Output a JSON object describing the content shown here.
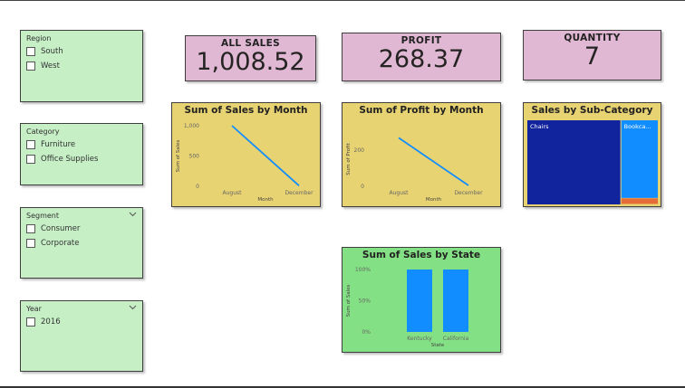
{
  "slicers": {
    "region": {
      "title": "Region",
      "has_dropdown": false,
      "items": [
        {
          "label": "South"
        },
        {
          "label": "West"
        }
      ]
    },
    "category": {
      "title": "Category",
      "has_dropdown": false,
      "items": [
        {
          "label": "Furniture"
        },
        {
          "label": "Office Supplies"
        }
      ]
    },
    "segment": {
      "title": "Segment",
      "has_dropdown": true,
      "items": [
        {
          "label": "Consumer"
        },
        {
          "label": "Corporate"
        }
      ]
    },
    "year": {
      "title": "Year",
      "has_dropdown": true,
      "items": [
        {
          "label": "2016"
        }
      ]
    }
  },
  "cards": {
    "all_sales": {
      "title": "ALL SALES",
      "value": "1,008.52"
    },
    "profit": {
      "title": "PROFIT",
      "value": "268.37"
    },
    "quantity": {
      "title": "QUANTITY",
      "value": "7"
    }
  },
  "colors": {
    "slicer_bg": "#c6efc6",
    "card_bg": "#e0b8d4",
    "chart_yellow": "#e8d372",
    "chart_green": "#84e084",
    "series_blue": "#118dff",
    "treemap_dark": "#12239e",
    "treemap_orange": "#e66c37"
  },
  "chart_data": [
    {
      "id": "sales_by_month",
      "type": "line",
      "title": "Sum of Sales by Month",
      "xlabel": "Month",
      "ylabel": "Sum of Sales",
      "x": [
        "August",
        "December"
      ],
      "y_ticks": [
        "0",
        "500",
        "1,000"
      ],
      "ylim": [
        0,
        1000
      ],
      "series": [
        {
          "values": [
            1000,
            10
          ]
        }
      ],
      "grid": false
    },
    {
      "id": "profit_by_month",
      "type": "line",
      "title": "Sum of Profit by Month",
      "xlabel": "Month",
      "ylabel": "Sum of Profit",
      "x": [
        "August",
        "December"
      ],
      "y_ticks": [
        "0",
        "200"
      ],
      "ylim": [
        0,
        300
      ],
      "series": [
        {
          "values": [
            268,
            5
          ]
        }
      ],
      "grid": false
    },
    {
      "id": "sales_by_subcategory",
      "type": "treemap",
      "title": "Sales by Sub-Category",
      "tiles": [
        {
          "label": "Chairs",
          "share": 0.72,
          "color": "#12239e"
        },
        {
          "label": "Bookca...",
          "share": 0.26,
          "color": "#118dff"
        },
        {
          "label": "",
          "share": 0.02,
          "color": "#e66c37"
        }
      ]
    },
    {
      "id": "sales_by_state",
      "type": "bar",
      "title": "Sum of Sales by State",
      "xlabel": "State",
      "ylabel": "Sum of Sales",
      "categories": [
        "Kentucky",
        "California"
      ],
      "values": [
        100,
        100
      ],
      "y_ticks": [
        "0%",
        "50%",
        "100%"
      ],
      "ylim": [
        0,
        100
      ],
      "grid": false
    }
  ]
}
